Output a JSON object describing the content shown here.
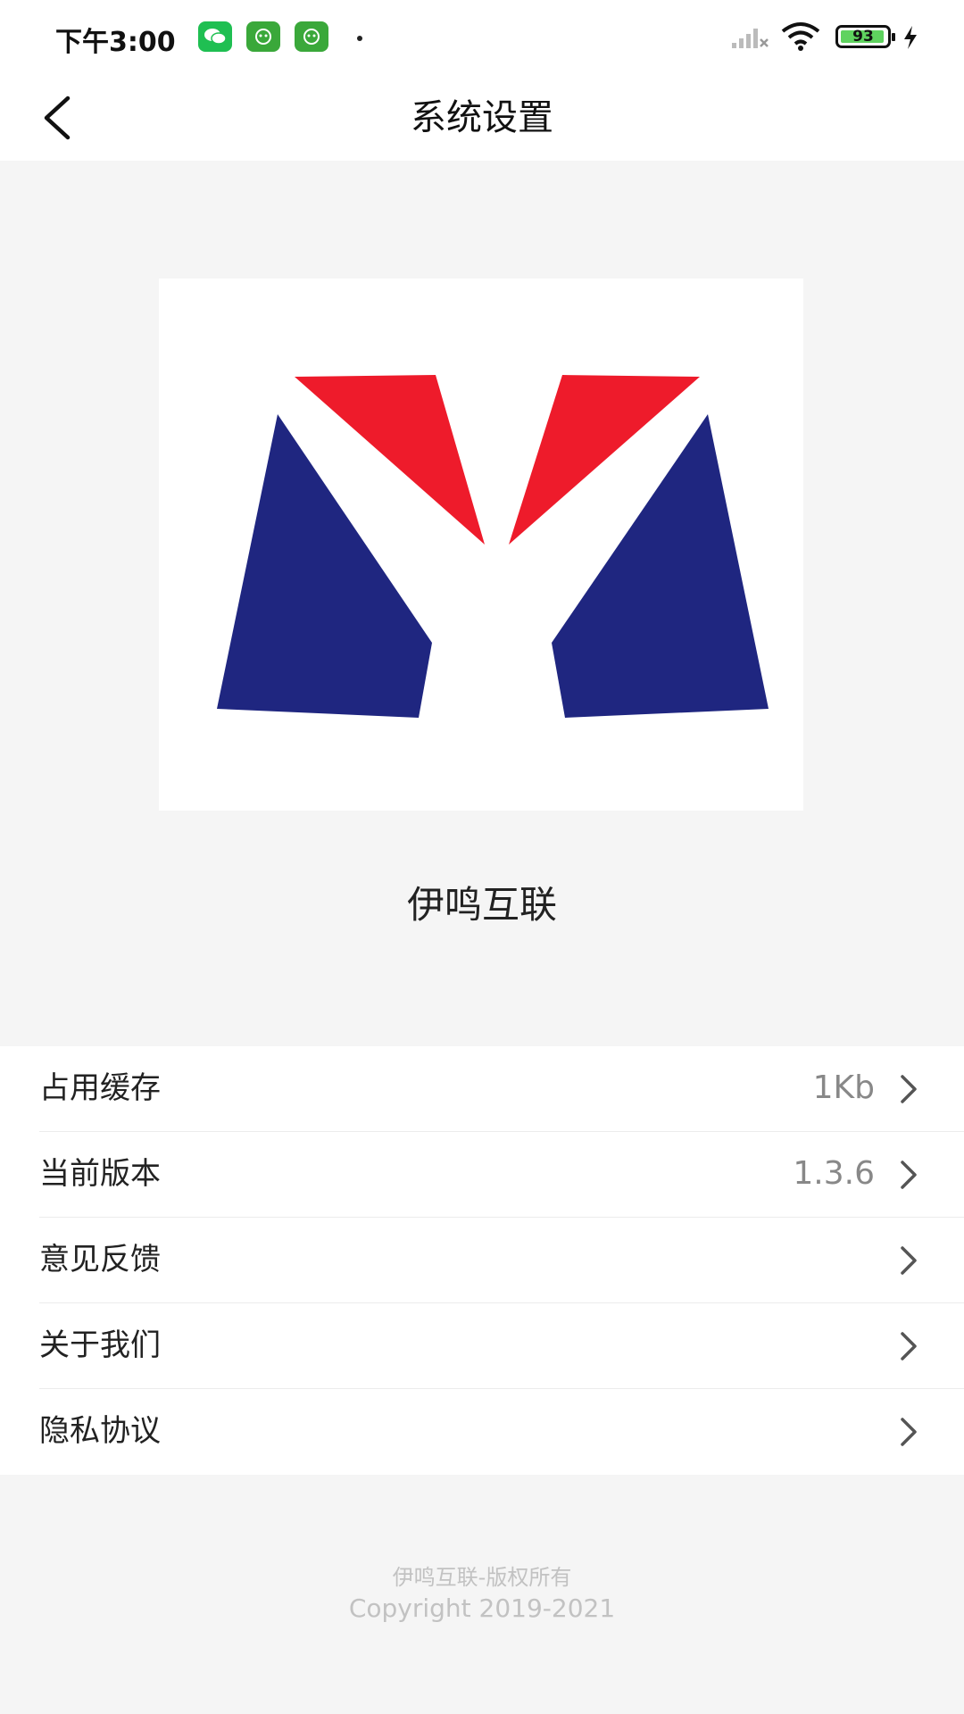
{
  "status_bar": {
    "time": "下午3:00",
    "battery_level": "93",
    "icons": [
      "wechat-icon",
      "app-icon",
      "app-icon",
      "dot-icon",
      "signal-icon",
      "wifi-icon",
      "battery-icon",
      "charging-icon"
    ]
  },
  "nav": {
    "back_icon": "chevron-left-icon",
    "title": "系统设置"
  },
  "brand": {
    "name": "伊鸣互联",
    "logo_colors": {
      "red": "#ee1b2b",
      "navy": "#1f2680"
    }
  },
  "menu": {
    "items": [
      {
        "label": "占用缓存",
        "value": "1Kb"
      },
      {
        "label": "当前版本",
        "value": "1.3.6"
      },
      {
        "label": "意见反馈",
        "value": ""
      },
      {
        "label": "关于我们",
        "value": ""
      },
      {
        "label": "隐私协议",
        "value": ""
      }
    ]
  },
  "footer": {
    "line1": "伊鸣互联-版权所有",
    "line2": "Copyright 2019-2021"
  }
}
